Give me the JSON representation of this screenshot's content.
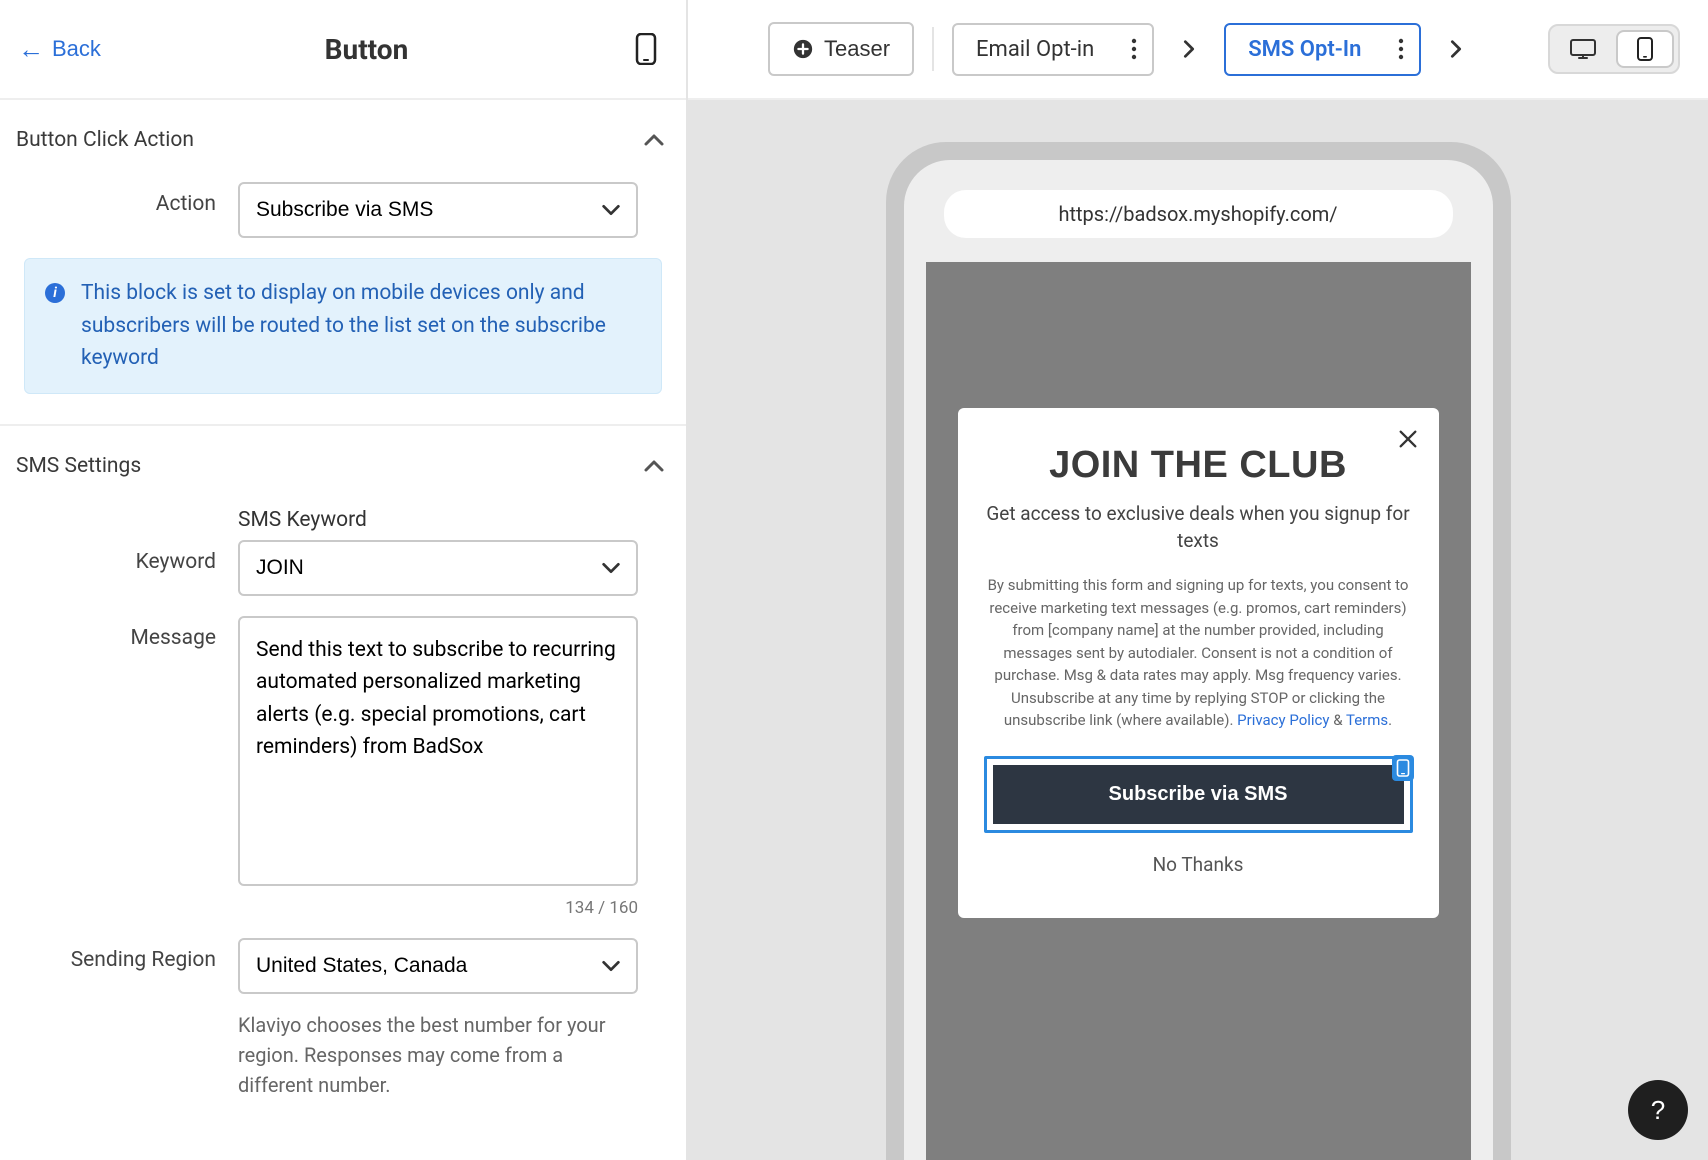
{
  "sidebar": {
    "back_label": "Back",
    "title": "Button",
    "section1": {
      "title": "Button Click Action",
      "action_label": "Action",
      "action_value": "Subscribe via SMS",
      "info": "This block is set to display on mobile devices only and subscribers will be routed to the list set on the subscribe keyword"
    },
    "section2": {
      "title": "SMS Settings",
      "keyword_label": "Keyword",
      "keyword_sub": "SMS Keyword",
      "keyword_value": "JOIN",
      "message_label": "Message",
      "message_value": "Send this text to subscribe to recurring automated personalized marketing alerts (e.g. special promotions, cart reminders) from BadSox",
      "char_count": "134 / 160",
      "region_label": "Sending Region",
      "region_value": "United States, Canada",
      "region_help": "Klaviyo chooses the best number for your region. Responses may come from a different number."
    }
  },
  "topbar": {
    "teaser": "Teaser",
    "email": "Email Opt-in",
    "sms": "SMS Opt-In"
  },
  "preview": {
    "url": "https://badsox.myshopify.com/",
    "popup": {
      "title": "JOIN THE CLUB",
      "subtitle": "Get access to exclusive deals when you signup for texts",
      "legal_pre": "By submitting this form and signing up for texts, you consent to receive marketing text messages (e.g. promos, cart reminders) from [company name] at the number provided, including messages sent by autodialer. Consent is not a condition of purchase. Msg & data rates may apply. Msg frequency varies. Unsubscribe at any time by replying STOP or clicking the unsubscribe link (where available). ",
      "privacy": "Privacy Policy",
      "amp": " & ",
      "terms": "Terms",
      "period": ".",
      "cta": "Subscribe via SMS",
      "no_thanks": "No Thanks"
    }
  },
  "help": "?"
}
